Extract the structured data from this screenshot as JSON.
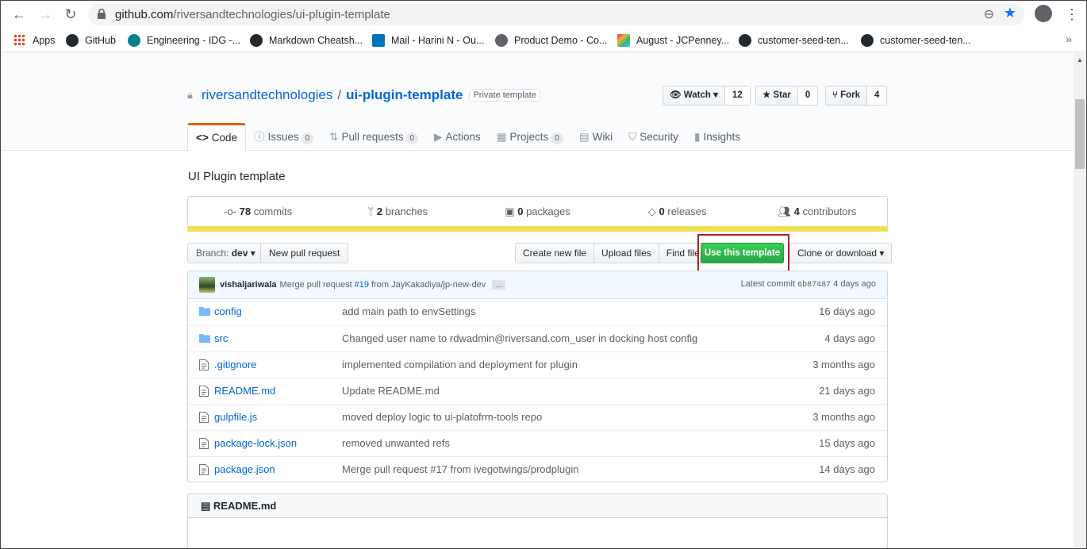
{
  "browser": {
    "url_host": "github.com",
    "url_path": "/riversandtechnologies/ui-plugin-template",
    "bookmarks": [
      {
        "label": "Apps",
        "color": "#e8453c"
      },
      {
        "label": "GitHub",
        "color": "#24292e"
      },
      {
        "label": "Engineering - IDG -...",
        "color": "#038387"
      },
      {
        "label": "Markdown Cheatsh...",
        "color": "#24292e"
      },
      {
        "label": "Mail - Harini N - Ou...",
        "color": "#0072c6"
      },
      {
        "label": "Product Demo - Co...",
        "color": "#5f6368"
      },
      {
        "label": "August - JCPenney...",
        "color": "#e2b43a"
      },
      {
        "label": "customer-seed-ten...",
        "color": "#24292e"
      },
      {
        "label": "customer-seed-ten...",
        "color": "#24292e"
      }
    ],
    "more_label": "»"
  },
  "repo": {
    "owner": "riversandtechnologies",
    "separator": "/",
    "name": "ui-plugin-template",
    "badge": "Private template",
    "watch_label": "Watch ▾",
    "watch_count": "12",
    "star_label": "Star",
    "star_count": "0",
    "fork_label": "Fork",
    "fork_count": "4"
  },
  "tabs": [
    {
      "label": "Code",
      "icon": "<>",
      "counter": ""
    },
    {
      "label": "Issues",
      "icon": "ⓘ",
      "counter": "0"
    },
    {
      "label": "Pull requests",
      "icon": "⇅",
      "counter": "0"
    },
    {
      "label": "Actions",
      "icon": "▶",
      "counter": ""
    },
    {
      "label": "Projects",
      "icon": "▦",
      "counter": "0"
    },
    {
      "label": "Wiki",
      "icon": "▤",
      "counter": ""
    },
    {
      "label": "Security",
      "icon": "⛉",
      "counter": ""
    },
    {
      "label": "Insights",
      "icon": "▮",
      "counter": ""
    }
  ],
  "description": "UI Plugin template",
  "summary": {
    "commits_num": "78",
    "commits_label": "commits",
    "branches_num": "2",
    "branches_label": "branches",
    "packages_num": "0",
    "packages_label": "packages",
    "releases_num": "0",
    "releases_label": "releases",
    "contributors_num": "4",
    "contributors_label": "contributors"
  },
  "language_color": "#f1e05a",
  "toolbar": {
    "branch_prefix": "Branch:",
    "branch_name": "dev",
    "new_pr": "New pull request",
    "create_file": "Create new file",
    "upload": "Upload files",
    "find": "Find file",
    "use_template": "Use this template",
    "clone": "Clone or download ▾"
  },
  "latest_commit": {
    "author": "vishaljariwala",
    "message_prefix": "Merge pull request",
    "pr": "#19",
    "message_suffix": "from JayKakadiya/jp-new-dev",
    "ellipsis": "…",
    "latest_label": "Latest commit",
    "sha": "6b87487",
    "age": "4 days ago"
  },
  "files": [
    {
      "name": "config",
      "type": "dir",
      "message": "add main path to envSettings",
      "age": "16 days ago"
    },
    {
      "name": "src",
      "type": "dir",
      "message": "Changed user name to rdwadmin@riversand.com_user in docking host config",
      "age": "4 days ago"
    },
    {
      "name": ".gitignore",
      "type": "file",
      "message": "implemented compilation and deployment for plugin",
      "age": "3 months ago"
    },
    {
      "name": "README.md",
      "type": "file",
      "message": "Update README.md",
      "age": "21 days ago"
    },
    {
      "name": "gulpfile.js",
      "type": "file",
      "message": "moved deploy logic to ui-platofrm-tools repo",
      "age": "3 months ago"
    },
    {
      "name": "package-lock.json",
      "type": "file",
      "message": "removed unwanted refs",
      "age": "15 days ago"
    },
    {
      "name": "package.json",
      "type": "file",
      "message": "Merge pull request #17 from ivegotwings/prodplugin",
      "age": "14 days ago"
    }
  ],
  "readme": {
    "title": "README.md"
  }
}
